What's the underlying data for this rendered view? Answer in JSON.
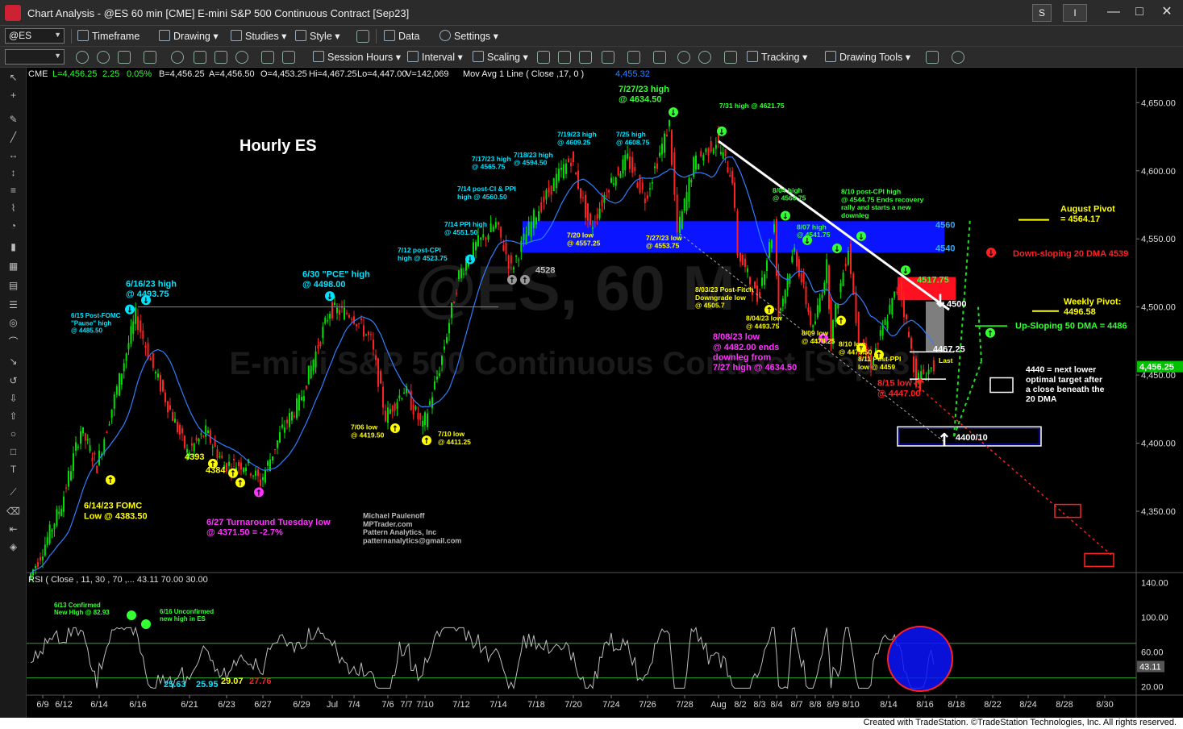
{
  "window": {
    "title": "Chart Analysis - @ES 60 min [CME] E-mini S&P 500 Continuous Contract [Sep23]",
    "btn_s": "S",
    "btn_i": "I",
    "min": "—",
    "max": "□",
    "close": "✕"
  },
  "toolbar1": {
    "symbol": "@ES",
    "timeframe": "Timeframe",
    "drawing": "Drawing",
    "studies": "Studies",
    "style": "Style",
    "data": "Data",
    "settings": "Settings"
  },
  "toolbar2": {
    "session_hours": "Session Hours",
    "interval": "Interval",
    "scaling": "Scaling",
    "tracking": "Tracking",
    "drawing_tools": "Drawing Tools"
  },
  "status": "Created with TradeStation. ©TradeStation Technologies, Inc. All rights reserved.",
  "colors": {
    "background": "#000000",
    "up_bar": "#00e000",
    "down_bar": "#ff2020",
    "ma_line": "#2f7fff",
    "cyan_label": "#00e5ff",
    "green_label": "#33ff33",
    "yellow_label": "#ffff00",
    "magenta_label": "#ff33ff",
    "red_label": "#ff2020",
    "blue_zone": "#0a14ff"
  },
  "header": {
    "exchange": "CME",
    "last": "L=4,456.25",
    "chg": "2.25",
    "pct": "0.05%",
    "bid": "B=4,456.25",
    "ask": "A=4,456.50",
    "open": "O=4,453.25",
    "hi": "Hi=4,467.25",
    "lo": "Lo=4,447.00",
    "vol": "V=142,069",
    "ma_study": "Mov Avg 1 Line ( Close ,17,  0 )",
    "ma_value": "4,455.32"
  },
  "watermark": {
    "line1": "@ES, 60 M",
    "line2": "E-mini S&P 500 Continuous Contract [Sep23]"
  },
  "chart_data": [
    {
      "type": "candlestick",
      "title": "Hourly ES",
      "xlabel": "",
      "ylabel": "",
      "ylim": [
        4305,
        4665
      ],
      "y_ticks": [
        "4,650.00",
        "4,600.00",
        "4,550.00",
        "4,500.00",
        "4,450.00",
        "4,400.00",
        "4,350.00"
      ],
      "y_tick_values": [
        4650,
        4600,
        4550,
        4500,
        4450,
        4400,
        4350
      ],
      "last_price_tag": "4,456.25",
      "last_price": 4456.25,
      "x_ticks": [
        "6/9",
        "6/12",
        "6/14",
        "6/16",
        "6/21",
        "6/23",
        "6/27",
        "6/29",
        "Jul",
        "7/4",
        "7/6",
        "7/7",
        "7/10",
        "7/12",
        "7/14",
        "7/18",
        "7/20",
        "7/24",
        "7/26",
        "7/28",
        "Aug",
        "8/2",
        "8/3",
        "8/4",
        "8/7",
        "8/8",
        "8/9",
        "8/10",
        "8/14",
        "8/16",
        "8/18",
        "8/22",
        "8/24",
        "8/28",
        "8/30"
      ],
      "price_path": [
        {
          "x": "6/8",
          "y": 4300
        },
        {
          "x": "6/9",
          "y": 4318
        },
        {
          "x": "6/12",
          "y": 4355
        },
        {
          "x": "6/13",
          "y": 4410
        },
        {
          "x": "6/14",
          "y": 4383.5
        },
        {
          "x": "6/15",
          "y": 4440
        },
        {
          "x": "6/16",
          "y": 4493.75
        },
        {
          "x": "6/20",
          "y": 4455
        },
        {
          "x": "6/21",
          "y": 4393
        },
        {
          "x": "6/22",
          "y": 4408
        },
        {
          "x": "6/23",
          "y": 4384
        },
        {
          "x": "6/26",
          "y": 4385
        },
        {
          "x": "6/27",
          "y": 4371.5
        },
        {
          "x": "6/28",
          "y": 4410
        },
        {
          "x": "6/29",
          "y": 4430
        },
        {
          "x": "6/30",
          "y": 4498
        },
        {
          "x": "7/3",
          "y": 4495
        },
        {
          "x": "7/5",
          "y": 4475
        },
        {
          "x": "7/6",
          "y": 4419.5
        },
        {
          "x": "7/7",
          "y": 4440
        },
        {
          "x": "7/10",
          "y": 4411.25
        },
        {
          "x": "7/11",
          "y": 4455
        },
        {
          "x": "7/12",
          "y": 4523.75
        },
        {
          "x": "7/13",
          "y": 4545
        },
        {
          "x": "7/14",
          "y": 4560.5
        },
        {
          "x": "7/14b",
          "y": 4528
        },
        {
          "x": "7/17",
          "y": 4565.75
        },
        {
          "x": "7/18",
          "y": 4594.5
        },
        {
          "x": "7/19",
          "y": 4609.25
        },
        {
          "x": "7/20",
          "y": 4557.25
        },
        {
          "x": "7/24",
          "y": 4590
        },
        {
          "x": "7/25",
          "y": 4608.75
        },
        {
          "x": "7/26",
          "y": 4580
        },
        {
          "x": "7/27",
          "y": 4634.5
        },
        {
          "x": "7/27b",
          "y": 4553.75
        },
        {
          "x": "7/28",
          "y": 4605
        },
        {
          "x": "7/31",
          "y": 4621.75
        },
        {
          "x": "8/1",
          "y": 4595
        },
        {
          "x": "8/2",
          "y": 4540
        },
        {
          "x": "8/3",
          "y": 4505.7
        },
        {
          "x": "8/4",
          "y": 4560.75
        },
        {
          "x": "8/4b",
          "y": 4493.75
        },
        {
          "x": "8/7",
          "y": 4541.75
        },
        {
          "x": "8/8",
          "y": 4482
        },
        {
          "x": "8/9",
          "y": 4530
        },
        {
          "x": "8/9b",
          "y": 4478.25
        },
        {
          "x": "8/10",
          "y": 4544.75
        },
        {
          "x": "8/10b",
          "y": 4473.5
        },
        {
          "x": "8/11",
          "y": 4459
        },
        {
          "x": "8/14",
          "y": 4517.75
        },
        {
          "x": "8/15",
          "y": 4447
        },
        {
          "x": "8/16",
          "y": 4456.25
        }
      ],
      "ma_name": "Mov Avg 1 Line ( Close ,17,  0 )",
      "zones": [
        {
          "label_top": "4560",
          "label_bottom": "4540",
          "y_top": 4563,
          "y_bottom": 4540,
          "color": "blue",
          "from": "7/16",
          "to": "8/18"
        },
        {
          "label": "4517.75",
          "y_top": 4522,
          "y_bottom": 4505,
          "color": "red",
          "from": "8/14",
          "to": "8/17"
        },
        {
          "label_top": "4500",
          "label_bottom": "4467.25",
          "y_top": 4504,
          "y_bottom": 4467,
          "color": "gray",
          "from": "8/16",
          "to": "8/18"
        },
        {
          "label": "4400/10",
          "y_top": 4412,
          "y_bottom": 4398,
          "color": "navy",
          "from": "8/14",
          "to": "8/21"
        }
      ],
      "annotations": [
        {
          "text": "6/16/23 high\n@ 4493.75",
          "color": "cyan"
        },
        {
          "text": "6/15 Post-FOMC\n\"Pause\" high\n@ 4485.50",
          "color": "cyan"
        },
        {
          "text": "6/30 \"PCE\" high\n@ 4498.00",
          "color": "cyan"
        },
        {
          "text": "7/12 post-CPI\nhigh @ 4523.75",
          "color": "cyan"
        },
        {
          "text": "7/14 PPI high\n@ 4551.50",
          "color": "cyan"
        },
        {
          "text": "7/14 post-CI & PPI\nhigh @ 4560.50",
          "color": "cyan"
        },
        {
          "text": "7/17/23 high\n@ 4565.75",
          "color": "cyan"
        },
        {
          "text": "7/18/23 high\n@ 4594.50",
          "color": "cyan"
        },
        {
          "text": "7/19/23 high\n@ 4609.25",
          "color": "cyan"
        },
        {
          "text": "7/25 high\n@ 4608.75",
          "color": "cyan"
        },
        {
          "text": "7/27/23 high\n@ 4634.50",
          "color": "green"
        },
        {
          "text": "7/31 high @ 4621.75",
          "color": "green"
        },
        {
          "text": "8/04 high\n@ 4560.75",
          "color": "green"
        },
        {
          "text": "8/07 high\n@ 4541.75",
          "color": "green"
        },
        {
          "text": "8/10 post-CPI high\n@ 4544.75 Ends recovery\nrally and starts a new\ndownleg",
          "color": "green"
        },
        {
          "text": "6/14/23 FOMC\nLow @ 4383.50",
          "color": "yellow"
        },
        {
          "text": "4393",
          "color": "yellow"
        },
        {
          "text": "4384",
          "color": "yellow"
        },
        {
          "text": "7/06 low\n@ 4419.50",
          "color": "yellow"
        },
        {
          "text": "7/10 low\n@ 4411.25",
          "color": "yellow"
        },
        {
          "text": "7/20 low\n@ 4557.25",
          "color": "yellow"
        },
        {
          "text": "7/27/23 low\n@ 4553.75",
          "color": "yellow"
        },
        {
          "text": "4528",
          "color": "gray"
        },
        {
          "text": "8/03/23 Post-Fitch\nDowngrade low\n@ 4505.7",
          "color": "yellow"
        },
        {
          "text": "8/04/23 low\n@ 4493.75",
          "color": "yellow"
        },
        {
          "text": "8/09 low\n@ 4478.25",
          "color": "yellow"
        },
        {
          "text": "8/10 low\n@ 4473.50",
          "color": "yellow"
        },
        {
          "text": "8/11 Post-PPI\nlow @ 4459",
          "color": "yellow"
        },
        {
          "text": "6/27 Turnaround Tuesday low\n@ 4371.50 = -2.7%",
          "color": "magenta"
        },
        {
          "text": "8/08/23 low\n@ 4482.00 ends\ndownleg from\n7/27 high @ 4634.50",
          "color": "magenta"
        },
        {
          "text": "8/15 low\n@ 4447.00",
          "color": "red"
        },
        {
          "text": "Last",
          "color": "yellow"
        },
        {
          "text": "August Pivot\n= 4564.17",
          "color": "yellow"
        },
        {
          "text": "Down-sloping 20 DMA 4539",
          "color": "red"
        },
        {
          "text": "Weekly Pivot:\n4496.58",
          "color": "yellow"
        },
        {
          "text": "Up-Sloping 50 DMA = 4486",
          "color": "green"
        },
        {
          "text": "4440 = next lower\noptimal target after\na close beneath the\n20 DMA",
          "color": "white"
        },
        {
          "text": "Michael Paulenoff\nMPTrader.com\nPattern Analytics, Inc\npatternanalytics@gmail.com",
          "color": "gray"
        }
      ]
    },
    {
      "type": "line",
      "title": "RSI ( Close , 11, 30 , 70 ,... 43.11  70.00  30.00",
      "ylim": [
        10,
        150
      ],
      "y_ticks": [
        "140.00",
        "100.00",
        "60.00",
        "20.00"
      ],
      "y_tick_values": [
        140,
        100,
        60,
        20
      ],
      "last_value_tag": "43.11",
      "last_value": 43.11,
      "levels": [
        70,
        30
      ],
      "annotations": [
        {
          "text": "6/13 Confirmed\nNew High @ 82.93",
          "color": "green"
        },
        {
          "text": "6/16 Unconfirmed\nnew high in ES",
          "color": "green"
        },
        {
          "text": "25.63",
          "color": "cyan"
        },
        {
          "text": "25.95",
          "color": "cyan"
        },
        {
          "text": "29.07",
          "color": "yellow"
        },
        {
          "text": "27.76",
          "color": "red"
        }
      ]
    }
  ]
}
